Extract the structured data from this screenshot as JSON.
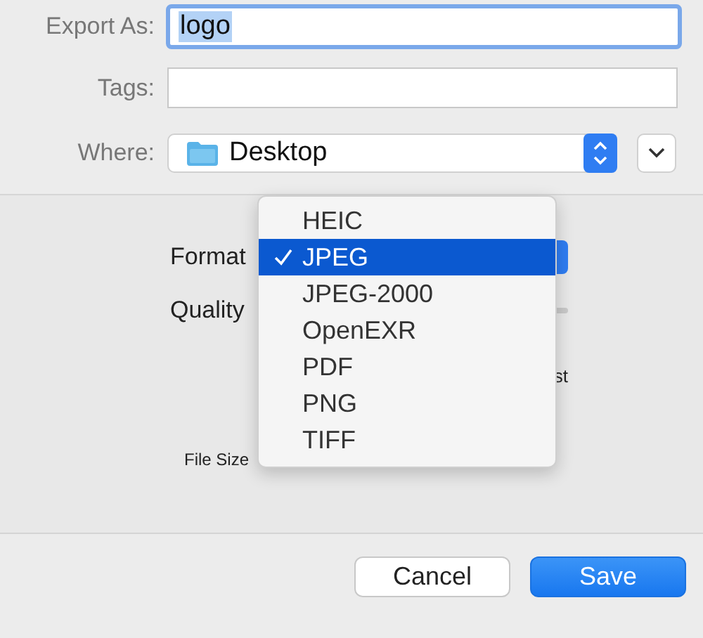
{
  "export_as": {
    "label": "Export As:",
    "value": "logo",
    "text_selected": true
  },
  "tags": {
    "label": "Tags:"
  },
  "where": {
    "label": "Where:",
    "value": "Desktop"
  },
  "format": {
    "label": "Format"
  },
  "quality": {
    "label": "Quality"
  },
  "quality_scale": {
    "label": "st"
  },
  "file_size": {
    "label": "File Size"
  },
  "format_menu": [
    {
      "label": "HEIC",
      "selected": false
    },
    {
      "label": "JPEG",
      "selected": true
    },
    {
      "label": "JPEG-2000",
      "selected": false
    },
    {
      "label": "OpenEXR",
      "selected": false
    },
    {
      "label": "PDF",
      "selected": false
    },
    {
      "label": "PNG",
      "selected": false
    },
    {
      "label": "TIFF",
      "selected": false
    }
  ],
  "buttons": [
    {
      "label": "Cancel",
      "kind": "cancel"
    },
    {
      "label": "Save",
      "kind": "default"
    }
  ]
}
